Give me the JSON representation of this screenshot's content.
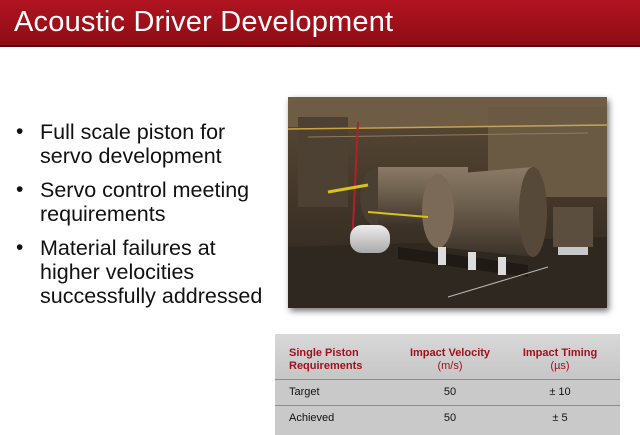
{
  "slide": {
    "title": "Acoustic Driver Development",
    "bullets": [
      "Full scale piston for servo development",
      "Servo control meeting requirements",
      "Material failures at higher velocities successfully addressed"
    ]
  },
  "photo": {
    "description_icon": "piston-rig-photo"
  },
  "table": {
    "headers": [
      {
        "title": "Single Piston Requirements",
        "unit": ""
      },
      {
        "title": "Impact Velocity",
        "unit": "(m/s)"
      },
      {
        "title": "Impact Timing",
        "unit": "(µs)"
      }
    ],
    "rows": [
      [
        "Target",
        "50",
        "± 10"
      ],
      [
        "Achieved",
        "50",
        "± 5"
      ]
    ]
  },
  "colors": {
    "title_bar": "#a0101c",
    "header_text": "#a50f1c"
  }
}
